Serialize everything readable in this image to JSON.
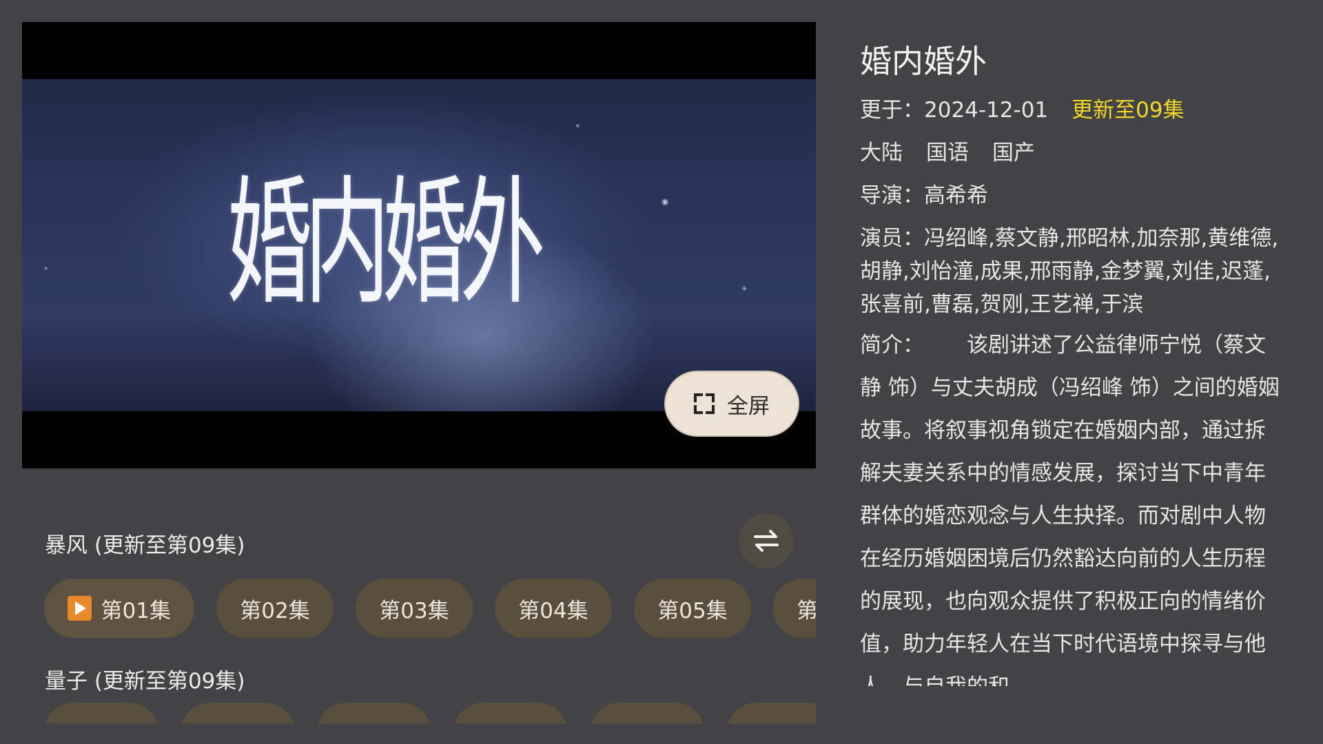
{
  "player": {
    "title_art": "婚内婚外",
    "fullscreen_label": "全屏"
  },
  "sources": [
    {
      "title": "暴风 (更新至第09集)",
      "episodes": [
        "第01集",
        "第02集",
        "第03集",
        "第04集",
        "第05集",
        "第"
      ]
    },
    {
      "title": "量子 (更新至第09集)"
    }
  ],
  "info": {
    "title": "婚内婚外",
    "updated_label": "更于：",
    "updated_date": "2024-12-01",
    "update_status": "更新至09集",
    "region": "大陆",
    "language": "国语",
    "category": "国产",
    "director_label": "导演：",
    "director": "高希希",
    "cast_label": "演员：",
    "cast": "冯绍峰,蔡文静,邢昭林,加奈那,黄维德,胡静,刘怡潼,成果,邢雨静,金梦翼,刘佳,迟蓬,张喜前,曹磊,贺刚,王艺禅,于滨",
    "synopsis_label": "简介：",
    "synopsis": "该剧讲述了公益律师宁悦（蔡文静 饰）与丈夫胡成（冯绍峰 饰）之间的婚姻故事。将叙事视角锁定在婚姻内部，通过拆解夫妻关系中的情感发展，探讨当下中青年群体的婚恋观念与人生抉择。而对剧中人物在经历婚姻困境后仍然豁达向前的人生历程的展现，也向观众提供了积极正向的情绪价值，助力年轻人在当下时代语境中探寻与他人、与自我的和"
  },
  "colors": {
    "background": "#434345",
    "episode_button": "#5a4e3d",
    "update_status": "#f0d72a",
    "play_icon": "#e98a2a",
    "fullscreen_button": "#ece3d6"
  }
}
